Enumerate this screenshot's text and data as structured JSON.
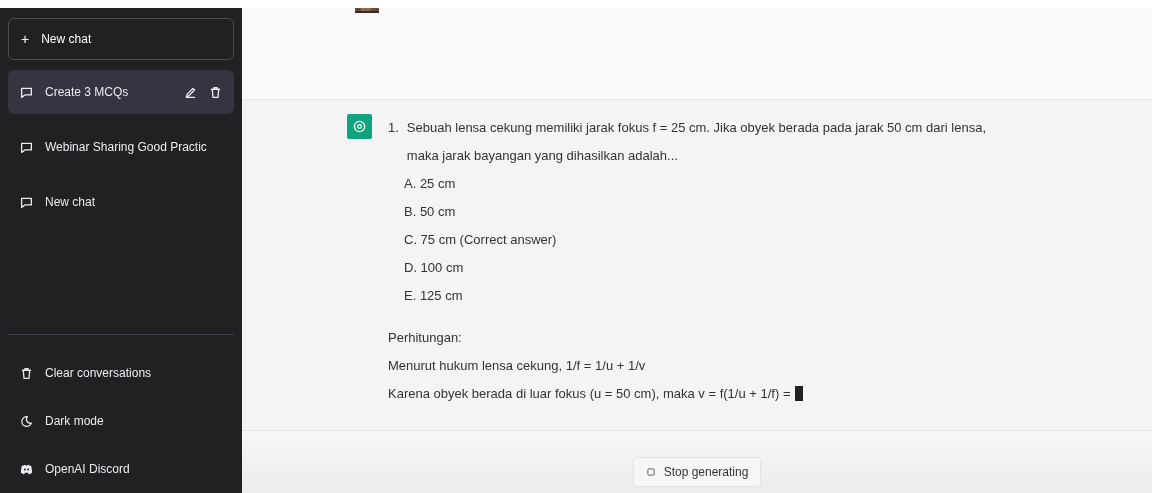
{
  "sidebar": {
    "new_chat": {
      "label": "New chat",
      "icon": "+"
    },
    "items": [
      {
        "label": "Create 3 MCQs",
        "selected": true
      },
      {
        "label": "Webinar Sharing Good Practic",
        "selected": false
      },
      {
        "label": "New chat",
        "selected": false
      }
    ],
    "footer": [
      {
        "kind": "trash",
        "label": "Clear conversations"
      },
      {
        "kind": "moon",
        "label": "Dark mode"
      },
      {
        "kind": "discord",
        "label": "OpenAI Discord"
      }
    ]
  },
  "message": {
    "number": "1.",
    "question": "Sebuah lensa cekung memiliki jarak fokus f = 25 cm. Jika obyek berada pada jarak 50 cm dari lensa, maka jarak bayangan yang dihasilkan adalah...",
    "options": [
      "A. 25 cm",
      "B. 50 cm",
      "C. 75 cm (Correct answer)",
      "D. 100 cm",
      "E. 125 cm"
    ],
    "lines": [
      "Perhitungan:",
      "Menurut hukum lensa cekung, 1/f = 1/u + 1/v",
      "Karena obyek berada di luar fokus (u = 50 cm), maka v = f(1/u + 1/f) ="
    ],
    "streaming": true
  },
  "stop_button": {
    "label": "Stop generating"
  }
}
